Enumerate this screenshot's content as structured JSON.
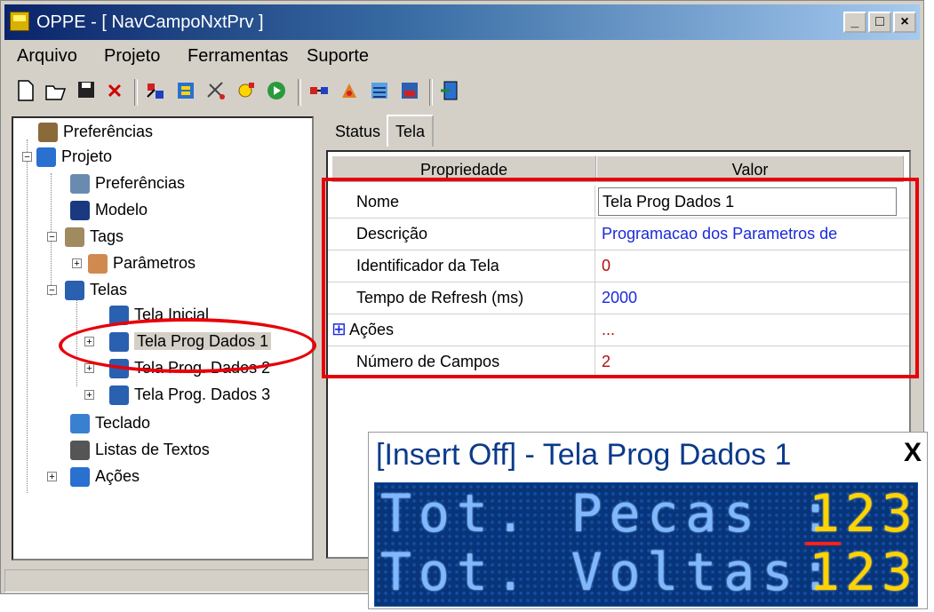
{
  "window": {
    "title": "OPPE - [ NavCampoNxtPrv ]",
    "caption_buttons": [
      "_",
      "□",
      "×"
    ]
  },
  "menubar": [
    "Arquivo",
    "Projeto",
    "Ferramentas",
    "Suporte"
  ],
  "toolbar_icons": [
    "new-icon",
    "open-icon",
    "save-icon",
    "delete-icon",
    "tool-1-icon",
    "tool-2-icon",
    "tool-3-icon",
    "tool-4-icon",
    "run-icon",
    "tool-5-icon",
    "tool-6-icon",
    "tool-7-icon",
    "tool-8-icon",
    "exit-icon"
  ],
  "tree": {
    "nodes": [
      {
        "label": "Preferências"
      },
      {
        "label": "Projeto"
      },
      {
        "label": "Preferências"
      },
      {
        "label": "Modelo"
      },
      {
        "label": "Tags"
      },
      {
        "label": "Parâmetros"
      },
      {
        "label": "Telas"
      },
      {
        "label": "Tela Inicial"
      },
      {
        "label": "Tela Prog Dados 1"
      },
      {
        "label": "Tela Prog. Dados 2"
      },
      {
        "label": "Tela Prog. Dados 3"
      },
      {
        "label": "Teclado"
      },
      {
        "label": "Listas de Textos"
      },
      {
        "label": "Ações"
      }
    ]
  },
  "tabs": [
    "Status",
    "Tela"
  ],
  "propgrid": {
    "headers": [
      "Propriedade",
      "Valor"
    ],
    "rows": [
      {
        "name": "Nome",
        "value": "Tela Prog Dados 1",
        "color": "#000000"
      },
      {
        "name": "Descrição",
        "value": "Programacao dos Parametros de",
        "color": "#1a2ad8"
      },
      {
        "name": "Identificador da Tela",
        "value": "0",
        "color": "#b01010"
      },
      {
        "name": "Tempo de Refresh (ms)",
        "value": "2000",
        "color": "#1a2ad8"
      },
      {
        "name": "Ações",
        "value": "...",
        "color": "#b01010"
      },
      {
        "name": "Número de Campos",
        "value": "2",
        "color": "#b01010"
      }
    ],
    "expand_sign": "⊞"
  },
  "lcd_window": {
    "title": "[Insert Off] - Tela Prog Dados 1",
    "close": "X",
    "line1": "Tot. Pecas :",
    "line2": "Tot. Voltas:",
    "value1": "123",
    "value2": "123"
  },
  "colors": {
    "highlight_red": "#e8000a",
    "lcd_background": "#08357a",
    "lcd_text": "#7fb8ff",
    "lcd_value": "#ffd400"
  }
}
